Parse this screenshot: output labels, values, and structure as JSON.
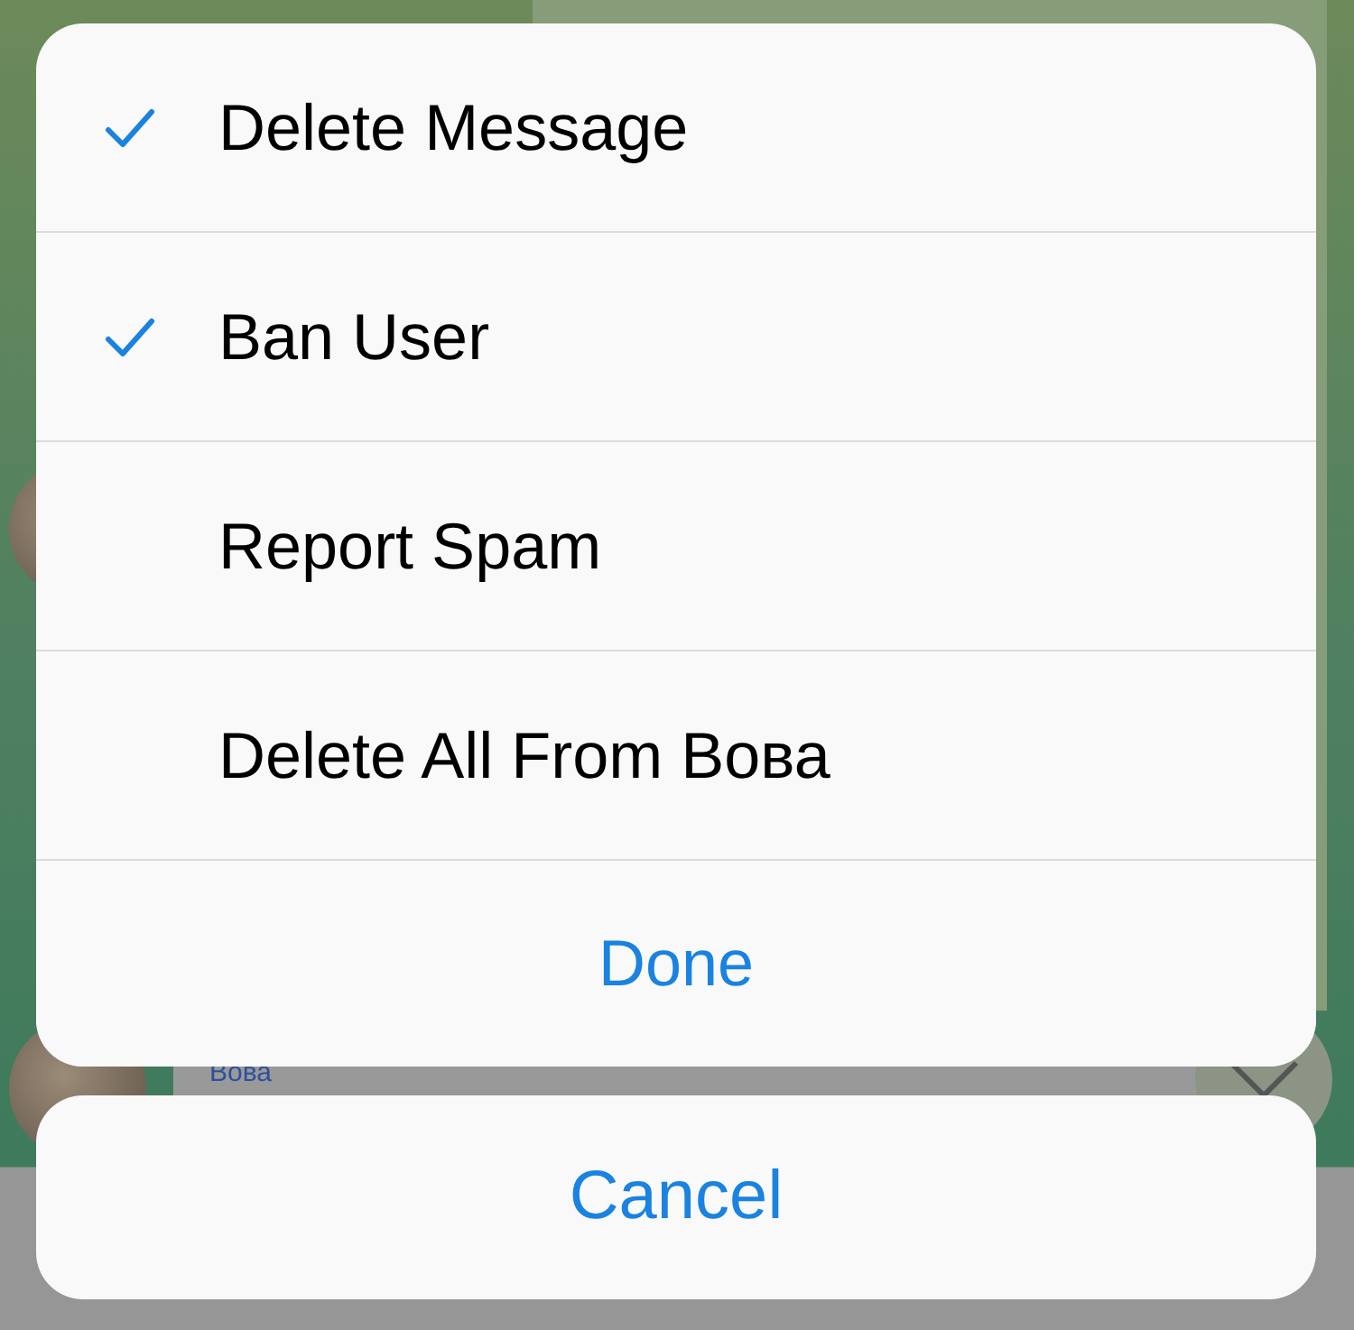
{
  "chat": {
    "sender_name": "Вова"
  },
  "action_sheet": {
    "options": [
      {
        "label": "Delete Message",
        "checked": true
      },
      {
        "label": "Ban User",
        "checked": true
      },
      {
        "label": "Report Spam",
        "checked": false
      },
      {
        "label": "Delete All From Вова",
        "checked": false
      }
    ],
    "confirm": "Done",
    "cancel": "Cancel"
  }
}
